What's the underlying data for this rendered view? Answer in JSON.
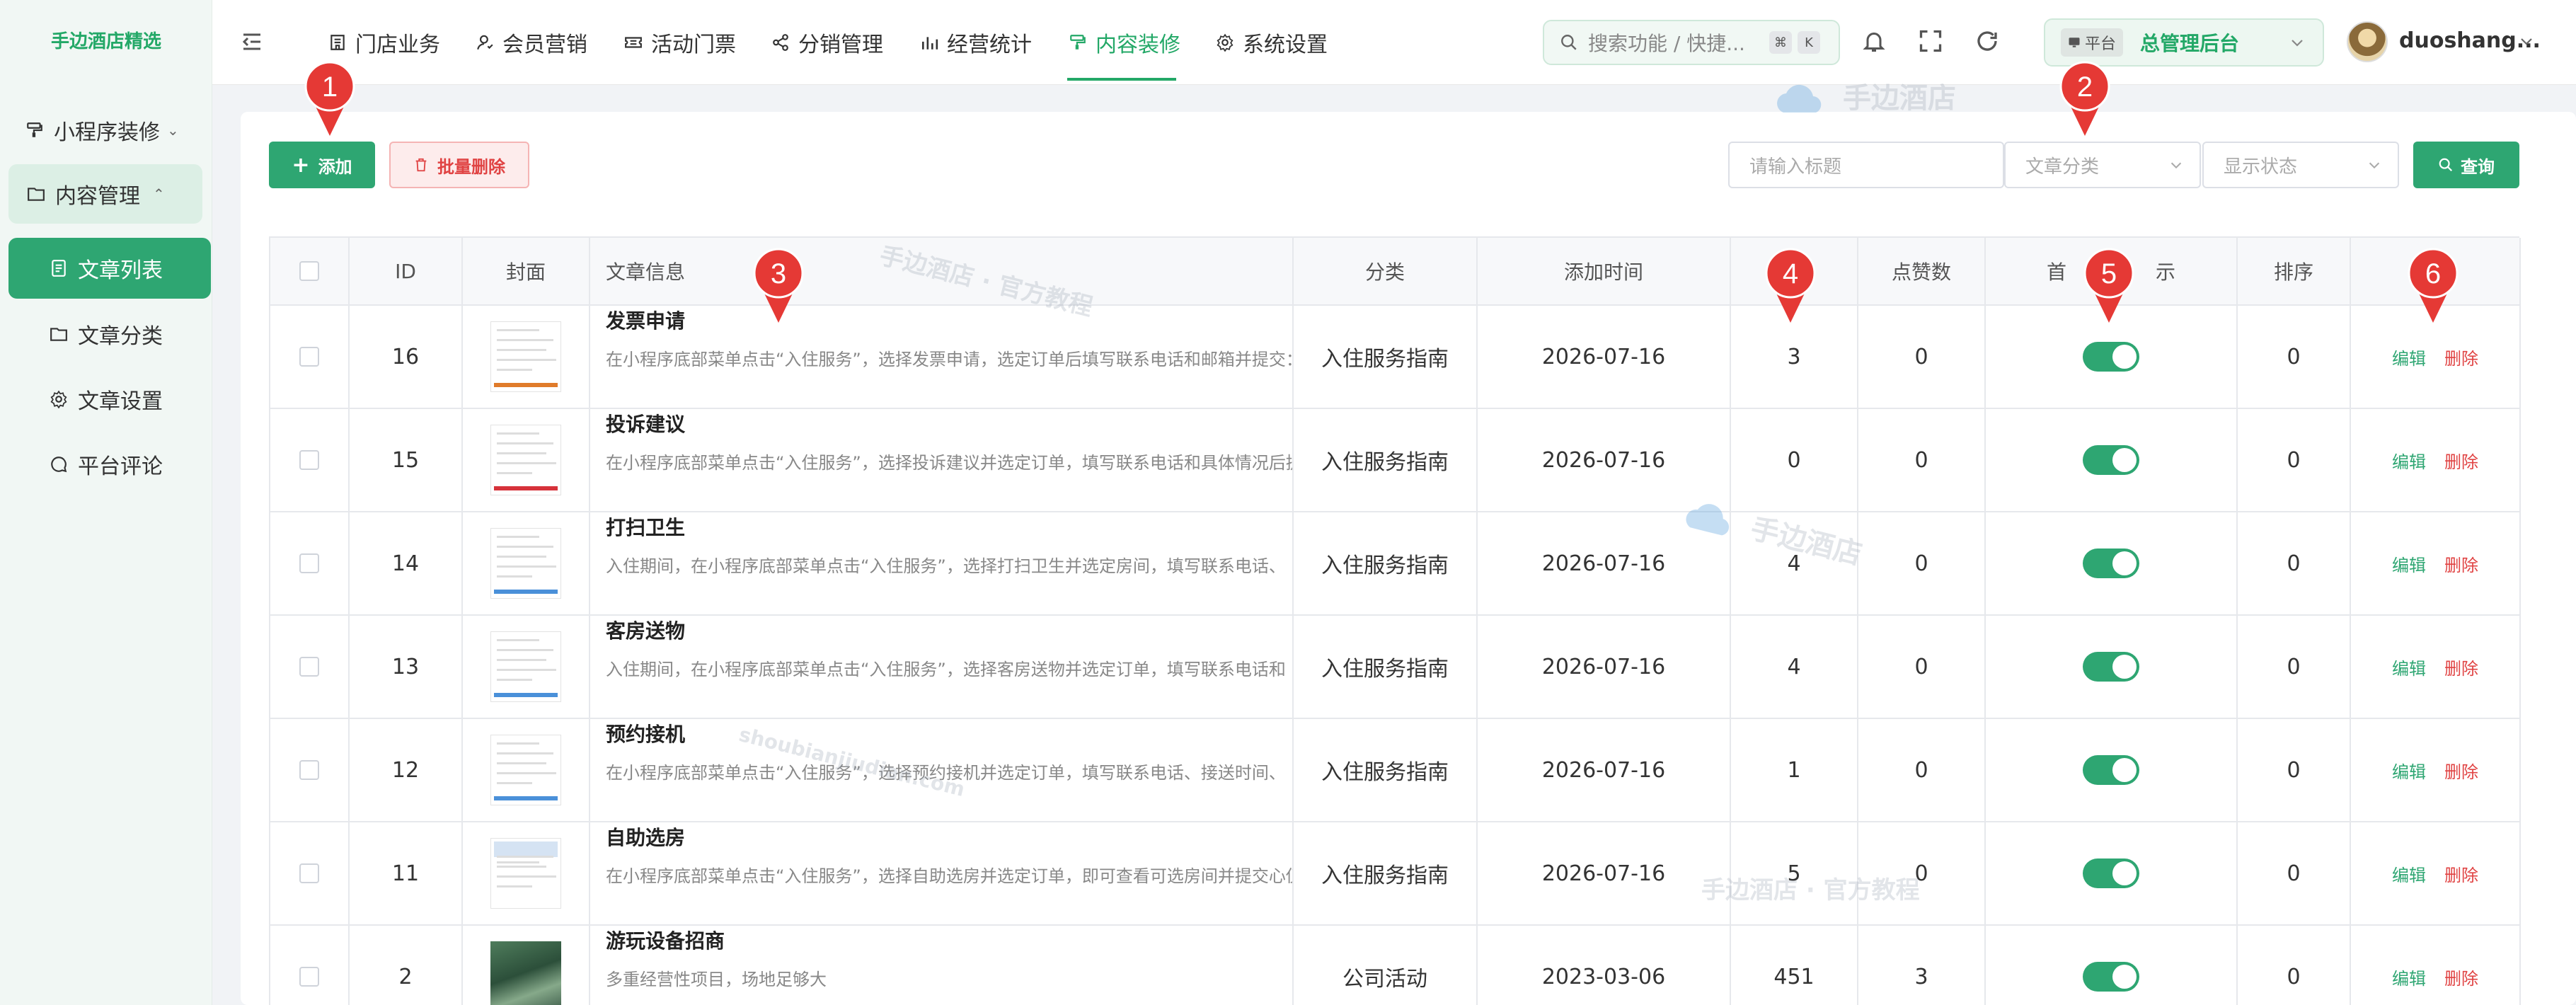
{
  "brand": "手边酒店精选",
  "sidebar": {
    "group1_label": "小程序装修",
    "group2_label": "内容管理",
    "items": [
      {
        "label": "文章列表",
        "icon": "document-list-icon"
      },
      {
        "label": "文章分类",
        "icon": "folder-icon"
      },
      {
        "label": "文章设置",
        "icon": "gear-icon"
      },
      {
        "label": "平台评论",
        "icon": "chat-bubble-icon"
      }
    ]
  },
  "topnav": {
    "items": [
      {
        "label": "门店业务",
        "icon": "store-icon"
      },
      {
        "label": "会员营销",
        "icon": "member-icon"
      },
      {
        "label": "活动门票",
        "icon": "ticket-icon"
      },
      {
        "label": "分销管理",
        "icon": "share-icon"
      },
      {
        "label": "经营统计",
        "icon": "bar-chart-icon"
      },
      {
        "label": "内容装修",
        "icon": "paint-roller-icon"
      },
      {
        "label": "系统设置",
        "icon": "gear-icon"
      }
    ],
    "active_index": 5
  },
  "search": {
    "placeholder": "搜索功能 / 快捷...",
    "kbd1": "⌘",
    "kbd2": "K"
  },
  "platform": {
    "badge": "平台",
    "name": "总管理后台"
  },
  "user": {
    "name": "duoshang..."
  },
  "toolbar": {
    "add_label": "添加",
    "batch_delete_label": "批量删除",
    "title_placeholder": "请输入标题",
    "category_placeholder": "文章分类",
    "status_placeholder": "显示状态",
    "query_label": "查询"
  },
  "table": {
    "headers": [
      "ID",
      "封面",
      "文章信息",
      "分类",
      "添加时间",
      "",
      "点赞数",
      "首",
      "示",
      "排序"
    ],
    "rows": [
      {
        "id": "16",
        "title": "发票申请",
        "desc": "在小程序底部菜单点击“入住服务”，选择发票申请，选定订单后填写联系电话和邮箱并提交：",
        "category": "入住服务指南",
        "date": "2026-07-16",
        "views": "3",
        "likes": "0",
        "sort": "0",
        "edit": "编辑",
        "del": "删除"
      },
      {
        "id": "15",
        "title": "投诉建议",
        "desc": "在小程序底部菜单点击“入住服务”，选择投诉建议并选定订单，填写联系电话和具体情况后提",
        "category": "入住服务指南",
        "date": "2026-07-16",
        "views": "0",
        "likes": "0",
        "sort": "0",
        "edit": "编辑",
        "del": "删除"
      },
      {
        "id": "14",
        "title": "打扫卫生",
        "desc": "入住期间，在小程序底部菜单点击“入住服务”，选择打扫卫生并选定房间，填写联系电话、",
        "category": "入住服务指南",
        "date": "2026-07-16",
        "views": "4",
        "likes": "0",
        "sort": "0",
        "edit": "编辑",
        "del": "删除"
      },
      {
        "id": "13",
        "title": "客房送物",
        "desc": "入住期间，在小程序底部菜单点击“入住服务”，选择客房送物并选定订单，填写联系电话和",
        "category": "入住服务指南",
        "date": "2026-07-16",
        "views": "4",
        "likes": "0",
        "sort": "0",
        "edit": "编辑",
        "del": "删除"
      },
      {
        "id": "12",
        "title": "预约接机",
        "desc": "在小程序底部菜单点击“入住服务”，选择预约接机并选定订单，填写联系电话、接送时间、",
        "category": "入住服务指南",
        "date": "2026-07-16",
        "views": "1",
        "likes": "0",
        "sort": "0",
        "edit": "编辑",
        "del": "删除"
      },
      {
        "id": "11",
        "title": "自助选房",
        "desc": "在小程序底部菜单点击“入住服务”，选择自助选房并选定订单，即可查看可选房间并提交心仪",
        "category": "入住服务指南",
        "date": "2026-07-16",
        "views": "5",
        "likes": "0",
        "sort": "0",
        "edit": "编辑",
        "del": "删除"
      },
      {
        "id": "2",
        "title": "游玩设备招商",
        "desc": "多重经营性项目，场地足够大",
        "category": "公司活动",
        "date": "2023-03-06",
        "views": "451",
        "likes": "3",
        "sort": "0",
        "edit": "编辑",
        "del": "删除"
      }
    ]
  },
  "markers": [
    "1",
    "2",
    "3",
    "4",
    "5",
    "6"
  ],
  "watermarks": {
    "logo_text": "手边酒店",
    "official": "手边酒店 · 官方教程",
    "domain": "shoubianjiudian.com"
  },
  "colors": {
    "accent": "#2ea672",
    "danger": "#e04343",
    "marker": "#e53935"
  }
}
